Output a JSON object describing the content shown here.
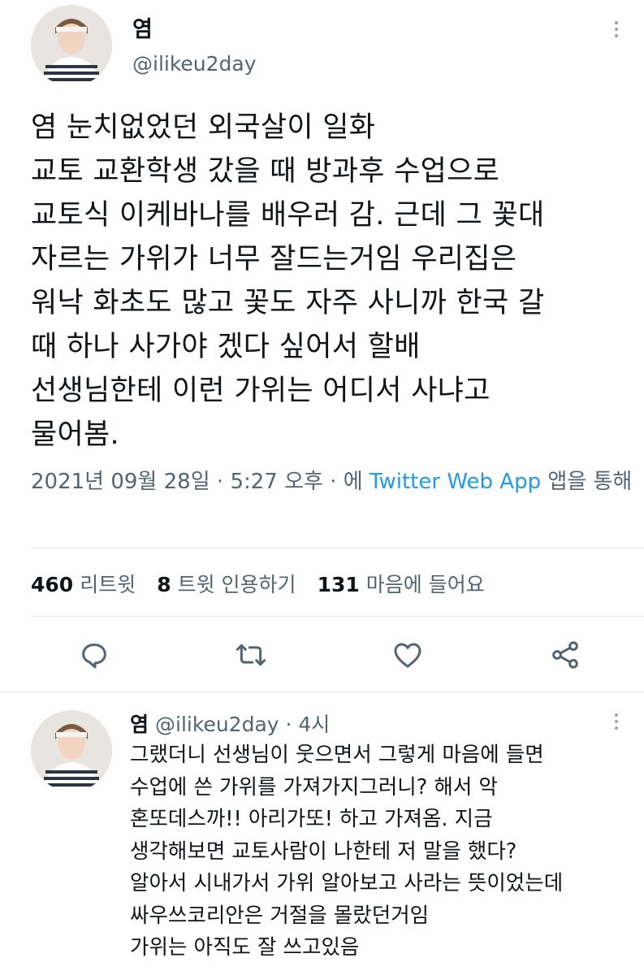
{
  "tweet": {
    "author": {
      "name": "염",
      "handle": "@ilikeu2day"
    },
    "text": "염 눈치없었던 외국살이 일화\n교토 교환학생 갔을 때 방과후 수업으로\n교토식 이케바나를 배우러 감. 근데 그 꽃대\n자르는 가위가 너무 잘드는거임 우리집은\n워낙 화초도 많고 꽃도 자주 사니까 한국 갈\n때 하나 사가야 겠다 싶어서 할배\n선생님한테 이런 가위는 어디서 사냐고\n물어봄.",
    "meta": {
      "date": "2021년 09월 28일",
      "sep1": " · ",
      "time": "5:27 오후",
      "sep2": " · 에 ",
      "source": "Twitter Web App",
      "via": " 앱을 통해"
    },
    "stats": [
      {
        "count": "460",
        "label": "리트윗"
      },
      {
        "count": "8",
        "label": "트윗 인용하기"
      },
      {
        "count": "131",
        "label": "마음에 들어요"
      }
    ],
    "actions": [
      "reply-icon",
      "retweet-icon",
      "like-icon",
      "share-icon"
    ]
  },
  "reply": {
    "name": "염",
    "handle": "@ilikeu2day",
    "time": " · 4시",
    "text": "그랬더니 선생님이 웃으면서 그렇게 마음에 들면\n수업에 쓴 가위를 가져가지그러니? 해서 악\n혼또데스까!! 아리가또! 하고 가져옴. 지금\n생각해보면 교토사람이 나한테 저 말을 했다?\n알아서 시내가서 가위 알아보고 사라는 뜻이었는데\n싸우쓰코리안은 거절을 몰랐던거임\n가위는 아직도 잘 쓰고있음"
  },
  "colors": {
    "link": "#1d9bf0",
    "muted": "#536471",
    "text": "#0f1419"
  }
}
